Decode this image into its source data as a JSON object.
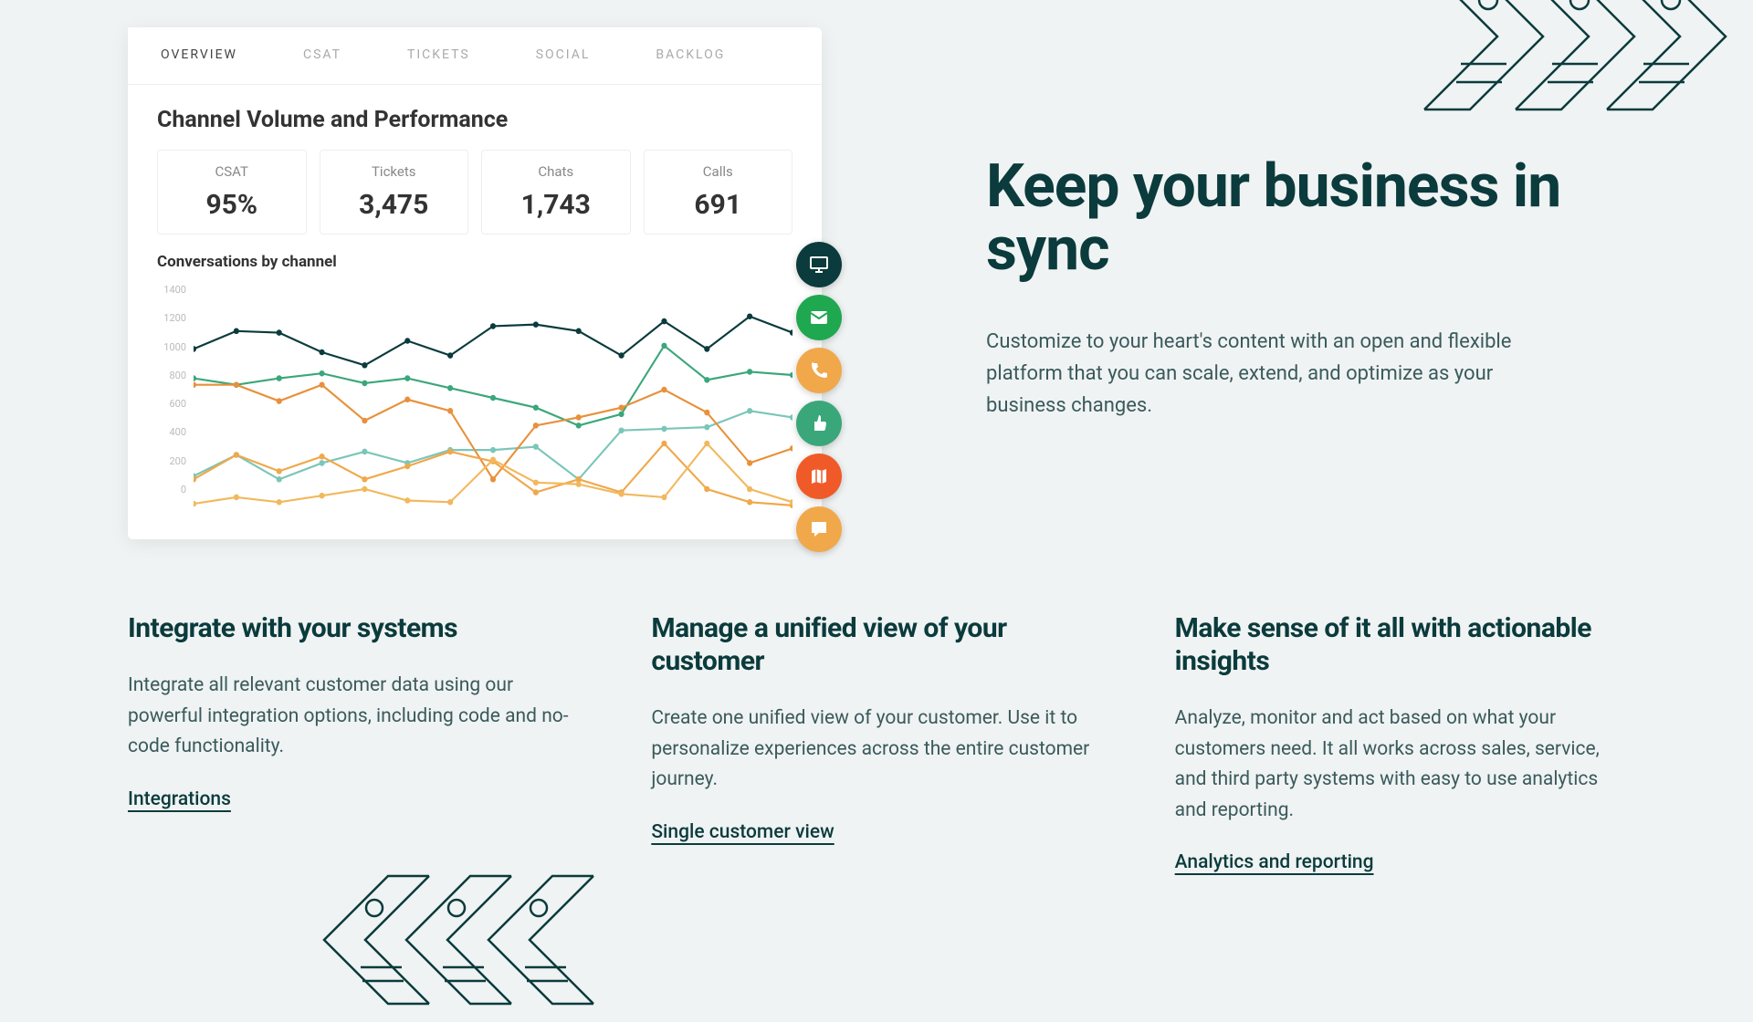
{
  "dashboard": {
    "tabs": [
      "OVERVIEW",
      "CSAT",
      "TICKETS",
      "SOCIAL",
      "BACKLOG"
    ],
    "active_tab": 0,
    "title": "Channel Volume and Performance",
    "metrics": [
      {
        "label": "CSAT",
        "value": "95%"
      },
      {
        "label": "Tickets",
        "value": "3,475"
      },
      {
        "label": "Chats",
        "value": "1,743"
      },
      {
        "label": "Calls",
        "value": "691"
      }
    ],
    "chart_subtitle": "Conversations by channel"
  },
  "chart_data": {
    "type": "line",
    "ylabel": "",
    "xlabel": "",
    "ylim": [
      0,
      1400
    ],
    "yticks": [
      0,
      200,
      400,
      600,
      800,
      1000,
      1200,
      1400
    ],
    "x": [
      1,
      2,
      3,
      4,
      5,
      6,
      7,
      8,
      9,
      10,
      11,
      12,
      13,
      14,
      15
    ],
    "series": [
      {
        "name": "dark-teal",
        "color": "#0b3b3c",
        "values": [
          1000,
          1110,
          1100,
          980,
          900,
          1050,
          960,
          1140,
          1150,
          1110,
          960,
          1170,
          1000,
          1200,
          1100
        ]
      },
      {
        "name": "green",
        "color": "#3aa77a",
        "values": [
          820,
          780,
          820,
          850,
          790,
          820,
          760,
          700,
          640,
          530,
          600,
          1020,
          810,
          860,
          840
        ]
      },
      {
        "name": "light-teal",
        "color": "#7bc6b9",
        "values": [
          220,
          350,
          200,
          300,
          370,
          300,
          380,
          380,
          400,
          200,
          500,
          510,
          520,
          620,
          580
        ]
      },
      {
        "name": "orange-upper",
        "color": "#e8903a",
        "values": [
          780,
          780,
          680,
          780,
          560,
          690,
          620,
          200,
          530,
          580,
          640,
          750,
          610,
          300,
          390
        ]
      },
      {
        "name": "orange-mid",
        "color": "#f0a84a",
        "values": [
          200,
          350,
          250,
          340,
          200,
          280,
          370,
          310,
          120,
          200,
          120,
          420,
          140,
          60,
          40
        ]
      },
      {
        "name": "orange-low",
        "color": "#f2b85e",
        "values": [
          50,
          90,
          60,
          100,
          140,
          70,
          60,
          320,
          180,
          170,
          110,
          90,
          420,
          140,
          60
        ]
      }
    ]
  },
  "floating_icons": [
    {
      "name": "monitor-icon",
      "bg": "#0b3b3c"
    },
    {
      "name": "mail-icon",
      "bg": "#1fa850"
    },
    {
      "name": "phone-icon",
      "bg": "#f0a84a"
    },
    {
      "name": "thumbs-up-icon",
      "bg": "#3aa77a"
    },
    {
      "name": "map-icon",
      "bg": "#f05a28"
    },
    {
      "name": "chat-icon",
      "bg": "#f0a84a"
    }
  ],
  "hero": {
    "title": "Keep your business in sync",
    "description": "Customize to your heart's content with an open and flexible platform that you can scale, extend, and optimize as your business changes."
  },
  "features": [
    {
      "title": "Integrate with your systems",
      "description": "Integrate all relevant customer data using our powerful integration options, including code and no-code functionality.",
      "link": "Integrations"
    },
    {
      "title": "Manage a unified view of your customer",
      "description": "Create one unified view of your customer. Use it to personalize experiences across the entire customer journey.",
      "link": "Single customer view"
    },
    {
      "title": "Make sense of it all with actionable insights",
      "description": "Analyze, monitor and act based on what your customers need. It all works across sales, service, and third party systems with easy to use analytics and reporting.",
      "link": "Analytics and reporting"
    }
  ]
}
